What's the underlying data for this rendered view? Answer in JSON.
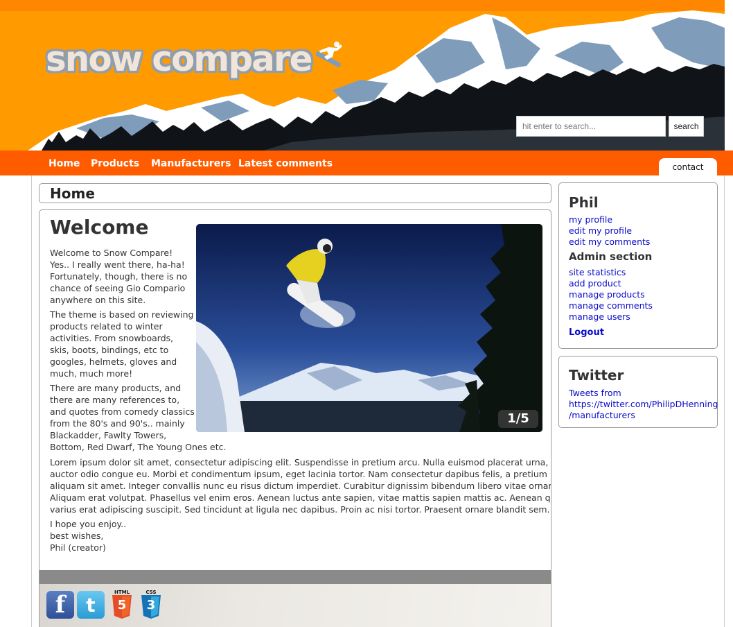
{
  "site": {
    "logo_text": "snow compare"
  },
  "search": {
    "placeholder": "hit enter to search...",
    "button_label": "search"
  },
  "nav": {
    "items": [
      {
        "label": "Home"
      },
      {
        "label": "Products"
      },
      {
        "label": "Manufacturers"
      },
      {
        "label": "Latest comments"
      }
    ],
    "contact_label": "contact"
  },
  "page": {
    "title": "Home"
  },
  "content": {
    "heading": "Welcome",
    "intro_lines": [
      "Welcome to Snow Compare!",
      "Yes.. I really went there, ha-ha!",
      "Fortunately, though, there is no",
      "chance of seeing Gio Compario",
      "anywhere on this site."
    ],
    "theme_lines": [
      "The theme is based on reviewing",
      "products related to winter",
      "activities. From snowboards,",
      "skis, boots, bindings, etc to",
      "googles, helmets, gloves and",
      "much, much more!"
    ],
    "refs_lines": [
      "There are many products, and",
      "there are many references to,",
      "and quotes from comedy classics",
      "from the 80's and 90's.. mainly",
      "Blackadder, Fawlty Towers,",
      "Bottom, Red Dwarf, The Young Ones etc."
    ],
    "lorem_lines": [
      "Lorem ipsum dolor sit amet, consectetur adipiscing elit. Suspendisse in pretium arcu. Nulla euismod placerat urna, et",
      "auctor odio congue eu. Morbi et condimentum ipsum, eget lacinia tortor. Nam consectetur dapibus felis, a pretium leo",
      "aliquam sit amet. Integer convallis nunc eu risus dictum imperdiet. Curabitur dignissim bibendum libero vitae ornare.",
      "Aliquam erat volutpat. Phasellus vel enim eros. Aenean luctus ante sapien, vitae mattis sapien mattis ac. Aenean quis eros",
      "varius erat adipiscing suscipit. Sed tincidunt at ligula nec dapibus. Proin ac nisi tortor. Praesent ornare blandit sem."
    ],
    "signoff_lines": [
      "I hope you enjoy..",
      "best wishes,",
      "Phil (creator)"
    ],
    "slideshow_counter": "1/5"
  },
  "footer": {
    "icons": [
      "facebook-icon",
      "twitter-icon",
      "html5-icon",
      "css3-icon"
    ],
    "html5_label": "HTML",
    "html5_num": "5",
    "css3_label": "CSS",
    "css3_num": "3"
  },
  "sidebar": {
    "user_name": "Phil",
    "user_links": [
      "my profile",
      "edit my profile",
      "edit my comments"
    ],
    "admin_heading": "Admin section",
    "admin_links": [
      "site statistics",
      "add product",
      "manage products",
      "manage comments",
      "manage users"
    ],
    "logout_label": "Logout",
    "twitter_heading": "Twitter",
    "twitter_lines": [
      "Tweets from",
      "https://twitter.com/PhilipDHenning",
      "/manufacturers"
    ]
  },
  "colors": {
    "header_orange": "#ff9a00",
    "nav_orange": "#ff5c00",
    "link_blue": "#0a0ac8"
  }
}
